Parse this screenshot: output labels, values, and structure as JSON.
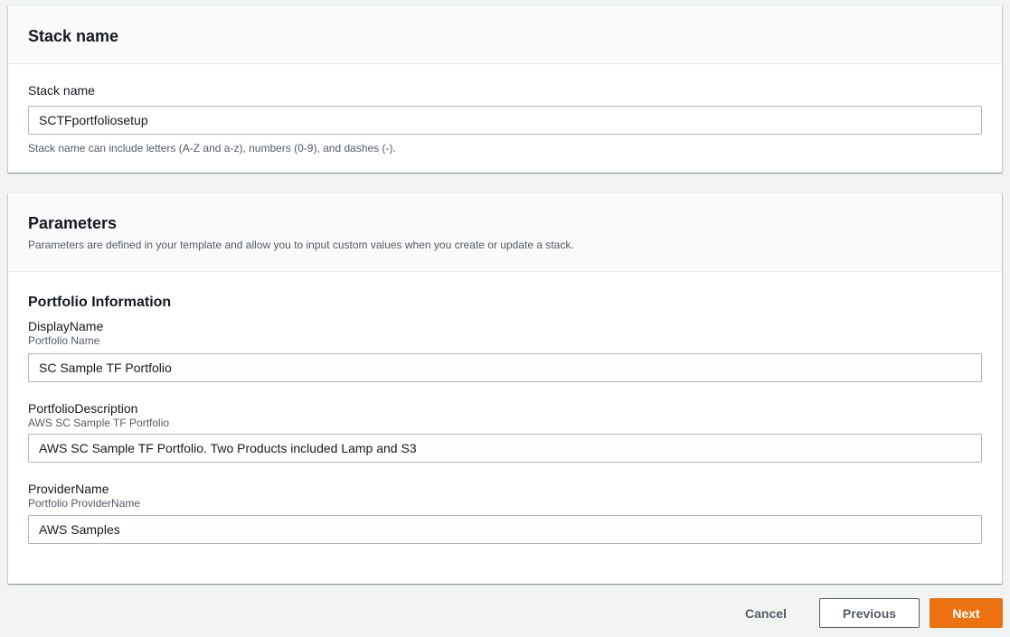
{
  "stack_name_panel": {
    "title": "Stack name",
    "field_label": "Stack name",
    "field_value": "SCTFportfoliosetup",
    "hint": "Stack name can include letters (A-Z and a-z), numbers (0-9), and dashes (-)."
  },
  "parameters_panel": {
    "title": "Parameters",
    "description": "Parameters are defined in your template and allow you to input custom values when you create or update a stack.",
    "section_heading": "Portfolio Information",
    "fields": [
      {
        "label": "DisplayName",
        "sublabel": "Portfolio Name",
        "value": "SC Sample TF Portfolio"
      },
      {
        "label": "PortfolioDescription",
        "sublabel": "AWS SC Sample TF Portfolio",
        "value": "AWS SC Sample TF Portfolio. Two Products included Lamp and S3"
      },
      {
        "label": "ProviderName",
        "sublabel": "Portfolio ProviderName",
        "value": "AWS Samples"
      }
    ]
  },
  "footer": {
    "cancel_label": "Cancel",
    "previous_label": "Previous",
    "next_label": "Next"
  },
  "colors": {
    "primary_button": "#ec7211",
    "background": "#f2f3f3"
  }
}
